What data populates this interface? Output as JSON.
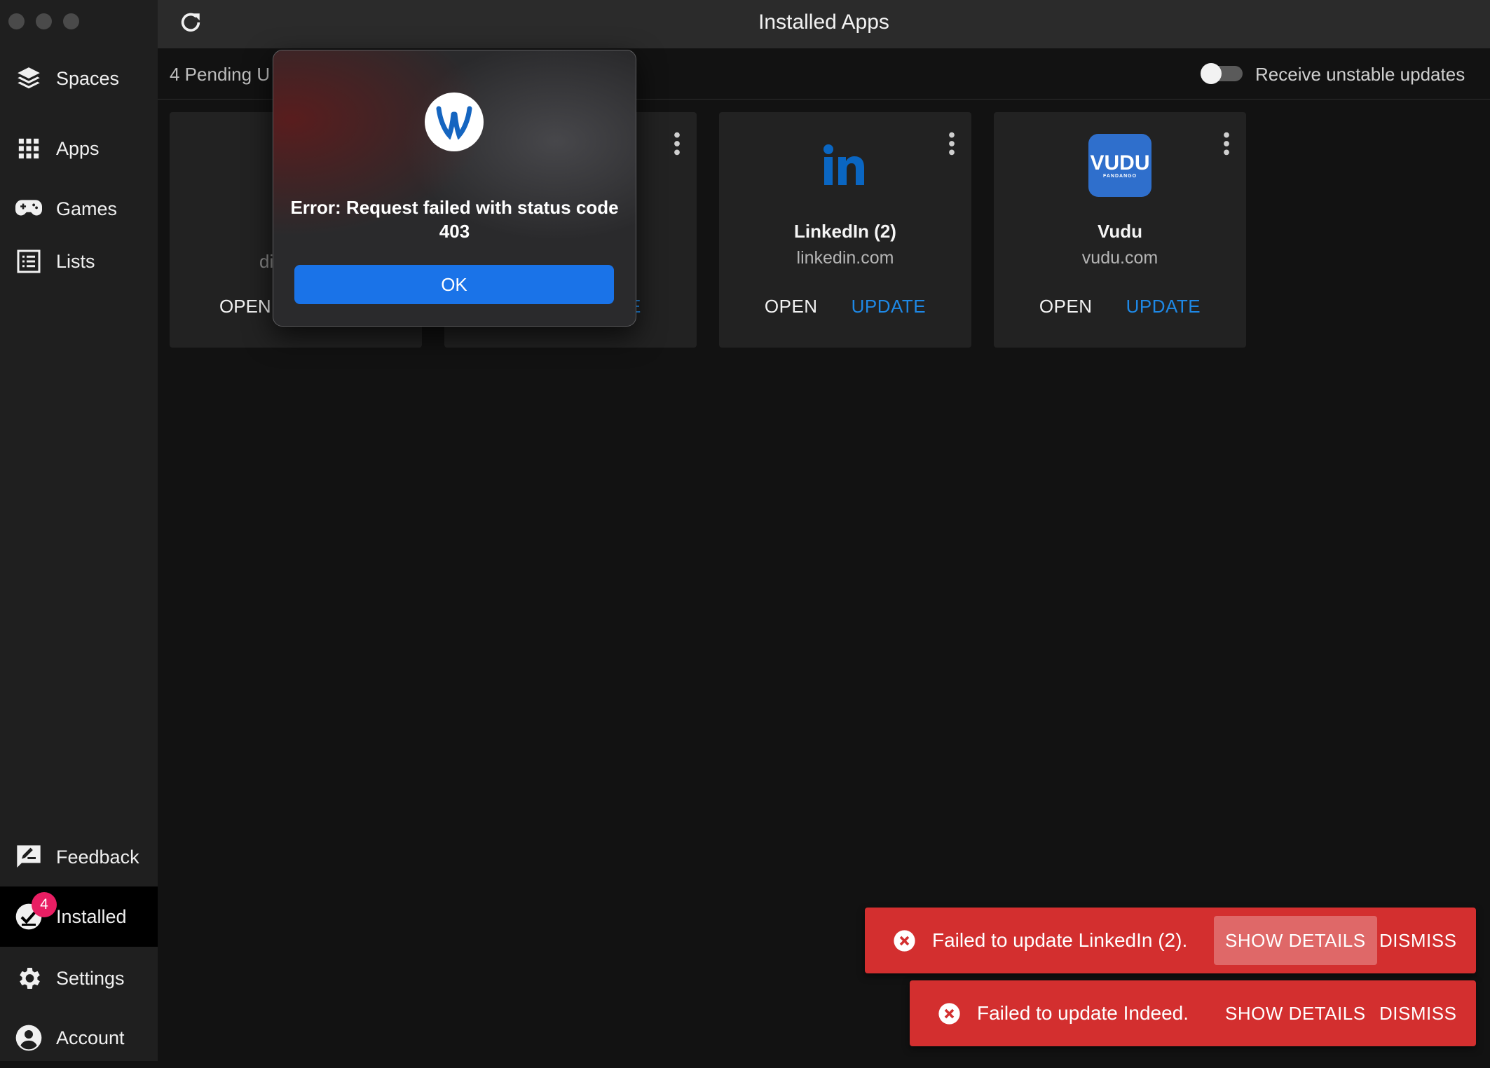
{
  "window": {
    "title": "Installed Apps"
  },
  "sidebar": {
    "items": [
      {
        "label": "Spaces",
        "icon": "layers-icon"
      },
      {
        "label": "Apps",
        "icon": "grid-icon"
      },
      {
        "label": "Games",
        "icon": "gamepad-icon"
      },
      {
        "label": "Lists",
        "icon": "list-icon"
      }
    ],
    "bottom_items": [
      {
        "label": "Feedback",
        "icon": "feedback-icon"
      },
      {
        "label": "Installed",
        "icon": "installed-icon",
        "badge": "4",
        "active": true
      },
      {
        "label": "Settings",
        "icon": "gear-icon"
      },
      {
        "label": "Account",
        "icon": "account-icon"
      }
    ]
  },
  "subheader": {
    "pending": "4 Pending U",
    "unstable_label": "Receive unstable updates",
    "unstable_enabled": false
  },
  "cards": [
    {
      "partial_domain": "di",
      "open_label": "OPEN"
    },
    {
      "partial_update": "E"
    },
    {
      "name": "LinkedIn (2)",
      "domain": "linkedin.com",
      "open_label": "OPEN",
      "update_label": "UPDATE",
      "icon": "linkedin-icon"
    },
    {
      "name": "Vudu",
      "domain": "vudu.com",
      "open_label": "OPEN",
      "update_label": "UPDATE",
      "icon": "vudu-icon",
      "icon_text": "VUDU",
      "icon_subtext": "FANDANGO"
    }
  ],
  "dialog": {
    "message": "Error: Request failed with status code 403",
    "ok_label": "OK"
  },
  "snackbars": [
    {
      "text": "Failed to update LinkedIn (2).",
      "details_label": "SHOW DETAILS",
      "dismiss_label": "DISMISS"
    },
    {
      "text": "Failed to update Indeed.",
      "details_label": "SHOW DETAILS",
      "dismiss_label": "DISMISS"
    }
  ],
  "colors": {
    "accent": "#1e88e5",
    "error": "#d32f2f",
    "badge": "#e91e63",
    "dialog_button": "#1a73e8"
  }
}
